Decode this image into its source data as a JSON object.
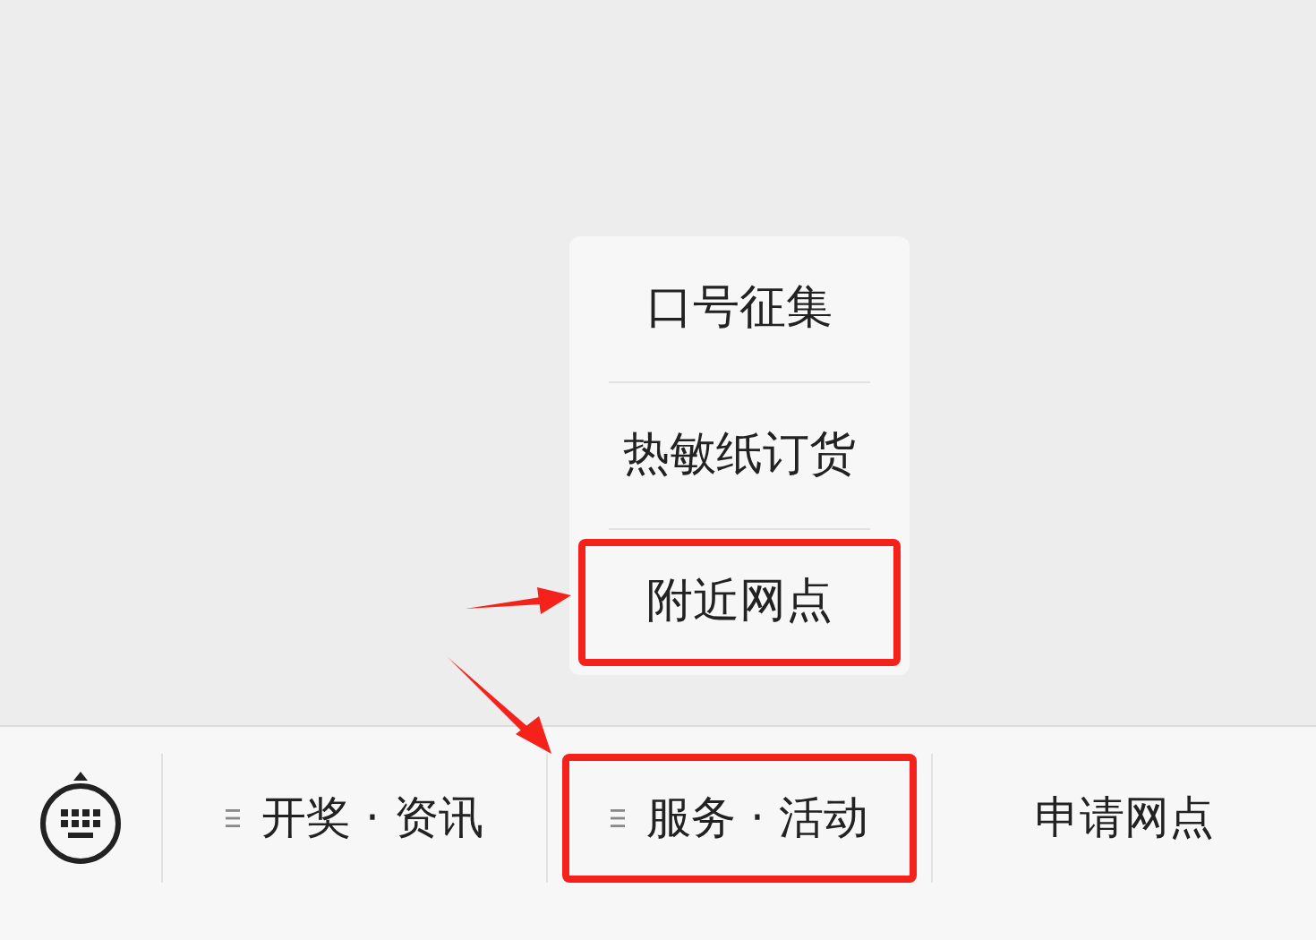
{
  "submenu": {
    "items": [
      {
        "label": "口号征集",
        "highlighted": false
      },
      {
        "label": "热敏纸订货",
        "highlighted": false
      },
      {
        "label": "附近网点",
        "highlighted": true
      }
    ]
  },
  "menu_bar": {
    "items": [
      {
        "label": "开奖 · 资讯",
        "has_submenu": true,
        "highlighted": false
      },
      {
        "label": "服务 · 活动",
        "has_submenu": true,
        "highlighted": true
      },
      {
        "label": "申请网点",
        "has_submenu": false,
        "highlighted": false
      }
    ]
  }
}
